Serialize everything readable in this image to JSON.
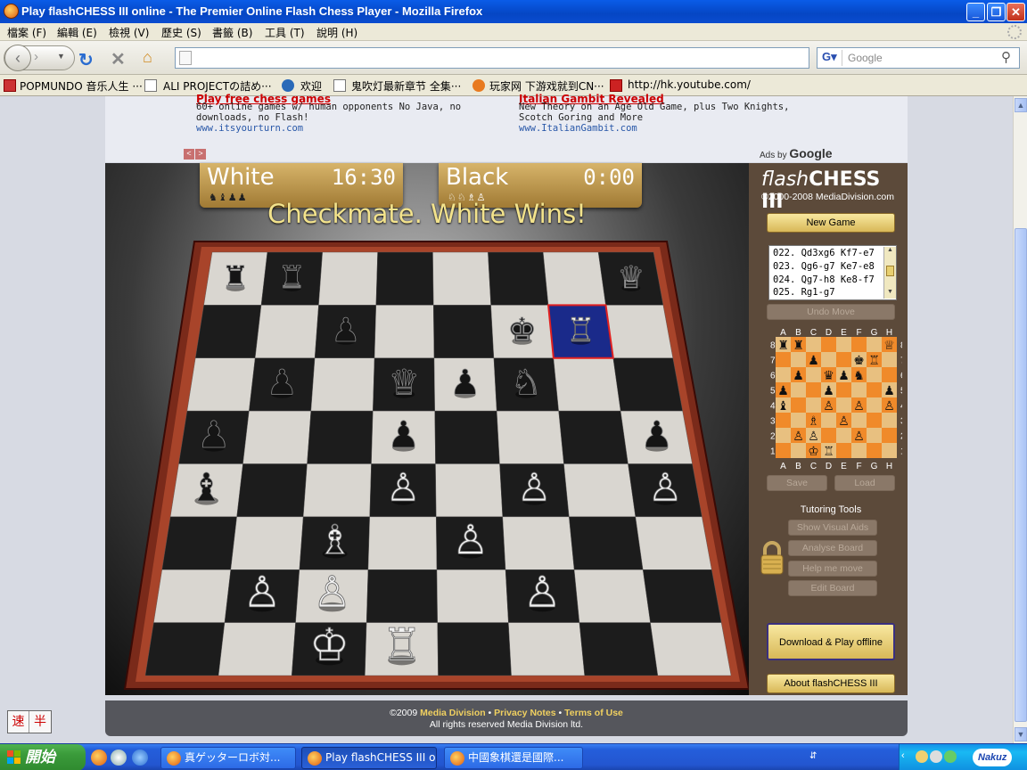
{
  "window": {
    "title": "Play flashCHESS III online - The Premier Online Flash Chess Player - Mozilla Firefox"
  },
  "menubar": {
    "items": [
      "檔案 (F)",
      "編輯 (E)",
      "檢視 (V)",
      "歷史 (S)",
      "書籤 (B)",
      "工具 (T)",
      "說明 (H)"
    ]
  },
  "navigation": {
    "url": "",
    "search_placeholder": "Google"
  },
  "bookmarks": [
    "POPMUNDO 音乐人生 ···",
    "ALI PROJECTの詰め···",
    "欢迎",
    "鬼吹灯最新章节 全集···",
    "玩家网 下游戏就到CN···",
    "http://hk.youtube.com/"
  ],
  "ads": {
    "left": {
      "title": "Play free chess games",
      "text": "60+ online games w/ human opponents No Java, no downloads, no Flash!",
      "url": "www.itsyourturn.com"
    },
    "right": {
      "title": "Italian Gambit Revealed",
      "text": "New Theory on an Age Old Game, plus Two Knights, Scotch Goring and More",
      "url": "www.ItalianGambit.com"
    },
    "nav": [
      "<",
      ">"
    ],
    "ads_by": "Ads by",
    "ads_brand": "Google"
  },
  "game": {
    "white_clock": {
      "name": "White",
      "time": "16:30",
      "captured": "♞♝♟♟"
    },
    "black_clock": {
      "name": "Black",
      "time": "0:00",
      "captured": "♘♘♗♙"
    },
    "status": "Checkmate. White Wins!"
  },
  "sidebar": {
    "logo_light": "flash",
    "logo_bold": "CHESS III",
    "copyright": "©2000-2008 MediaDivision.com",
    "new_game": "New Game",
    "moves": [
      "022. Qd3xg6  Kf7-e7",
      "023. Qg6-g7  Ke7-e8",
      "024. Qg7-h8  Ke8-f7",
      "025. Rg1-g7"
    ],
    "undo": "Undo Move",
    "save": "Save",
    "load": "Load",
    "tutoring_title": "Tutoring Tools",
    "tutoring": [
      "Show Visual Aids",
      "Analyse Board",
      "Help me move",
      "Edit Board"
    ],
    "download": "Download & Play offline",
    "about": "About flashCHESS III",
    "files": [
      "A",
      "B",
      "C",
      "D",
      "E",
      "F",
      "G",
      "H"
    ],
    "ranks": [
      "8",
      "7",
      "6",
      "5",
      "4",
      "3",
      "2",
      "1"
    ],
    "position": [
      [
        "♜",
        "♜",
        "",
        "",
        "",
        "",
        "",
        "♕"
      ],
      [
        "",
        "",
        "♟",
        "",
        "",
        "♚",
        "♖",
        ""
      ],
      [
        "",
        "♟",
        "",
        "♛",
        "♟",
        "♞",
        "",
        ""
      ],
      [
        "♟",
        "",
        "",
        "♟",
        "",
        "",
        "",
        "♟"
      ],
      [
        "♝",
        "",
        "",
        "♙",
        "",
        "♙",
        "",
        "♙"
      ],
      [
        "",
        "",
        "♗",
        "",
        "♙",
        "",
        "",
        ""
      ],
      [
        "",
        "♙",
        "♙",
        "",
        "",
        "♙",
        "",
        ""
      ],
      [
        "",
        "",
        "♔",
        "♖",
        "",
        "",
        "",
        ""
      ]
    ]
  },
  "footer": {
    "copy": "©2009",
    "links": [
      "Media Division",
      "Privacy Notes",
      "Terms of Use"
    ],
    "rights": "All rights reserved Media Division ltd."
  },
  "ime": [
    "速",
    "半"
  ],
  "taskbar": {
    "start": "開始",
    "tasks": [
      "真ゲッターロボ対...",
      "Play flashCHESS III o...",
      "中國象棋還是國際..."
    ],
    "active_index": 1,
    "tray_label": "Nakuz"
  },
  "colors": {
    "accent_gold": "#d8b858",
    "sidebar_brown": "#5c4a3a",
    "board_light": "#e8c080",
    "board_dark": "#f08a2a"
  }
}
